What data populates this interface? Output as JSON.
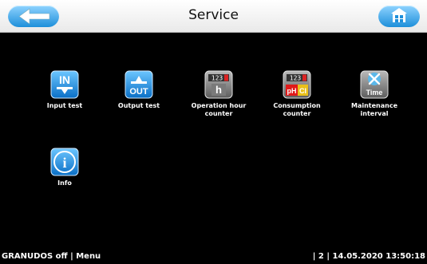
{
  "header": {
    "title": "Service",
    "back_icon": "arrow-left-icon",
    "home_icon": "home-icon"
  },
  "tiles": [
    {
      "label": "Input test",
      "icon": "input-test-icon",
      "icon_text": "IN"
    },
    {
      "label": "Output test",
      "icon": "output-test-icon",
      "icon_text": "OUT"
    },
    {
      "label": "Operation hour counter",
      "icon": "operation-hour-counter-icon",
      "icon_text": "h",
      "counter_digits": "123"
    },
    {
      "label": "Consumption counter",
      "icon": "consumption-counter-icon",
      "icon_text": "pH",
      "icon_text2": "Cl",
      "counter_digits": "123"
    },
    {
      "label": "Maintenance interval",
      "icon": "maintenance-interval-icon",
      "icon_text": "Time"
    },
    {
      "label": "Info",
      "icon": "info-icon",
      "icon_text": "i"
    }
  ],
  "status_bar": {
    "left": "GRANUDOS off | Menu",
    "right": "| 2 | 14.05.2020 13:50:18"
  },
  "colors": {
    "accent": "#1e8fda",
    "background": "#000000",
    "header": "#f2f2f2"
  }
}
